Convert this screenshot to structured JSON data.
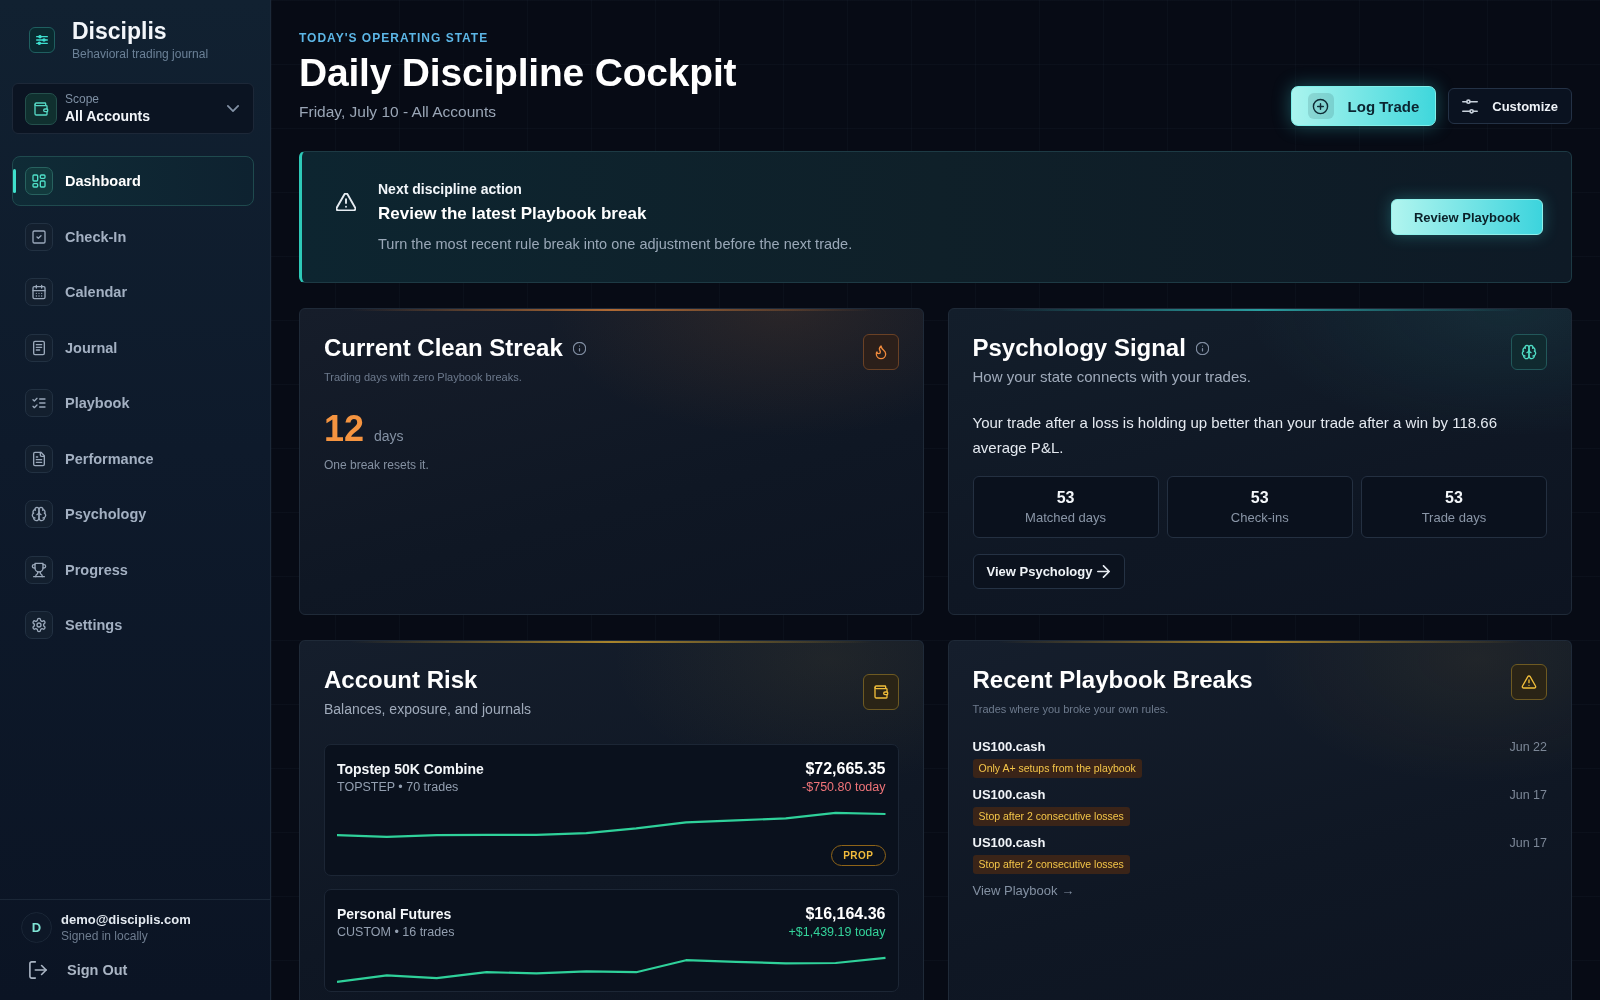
{
  "sidebar": {
    "brand": {
      "name": "Disciplis",
      "tagline": "Behavioral trading journal"
    },
    "scope": {
      "label": "Scope",
      "value": "All Accounts"
    },
    "nav": [
      {
        "label": "Dashboard",
        "selected": true
      },
      {
        "label": "Check-In",
        "selected": false
      },
      {
        "label": "Calendar",
        "selected": false
      },
      {
        "label": "Journal",
        "selected": false
      },
      {
        "label": "Playbook",
        "selected": false
      },
      {
        "label": "Performance",
        "selected": false
      },
      {
        "label": "Psychology",
        "selected": false
      },
      {
        "label": "Progress",
        "selected": false
      },
      {
        "label": "Settings",
        "selected": false
      }
    ],
    "user": {
      "initial": "D",
      "email": "demo@disciplis.com",
      "status": "Signed in locally"
    },
    "sign_out": "Sign Out"
  },
  "header": {
    "eyebrow": "TODAY'S OPERATING STATE",
    "title": "Daily Discipline Cockpit",
    "subtitle": "Friday, July 10 - All Accounts",
    "actions": [
      {
        "label": "Log Trade",
        "kind": "primary"
      },
      {
        "label": "Customize",
        "kind": "secondary"
      }
    ]
  },
  "banner": {
    "eyebrow": "Next discipline action",
    "title": "Review the latest Playbook break",
    "text": "Turn the most recent rule break into one adjustment before the next trade.",
    "button": "Review Playbook"
  },
  "streak_card": {
    "title": "Current Clean Streak",
    "subtitle": "Trading days with zero Playbook breaks.",
    "value": "12",
    "unit": "days",
    "note": "One break resets it."
  },
  "psychology_card": {
    "title": "Psychology Signal",
    "subtitle": "How your state connects with your trades.",
    "text": "Your trade after a loss is holding up better than your trade after a win by 118.66 average P&L.",
    "stats": [
      {
        "value": "53",
        "label": "Matched days"
      },
      {
        "value": "53",
        "label": "Check-ins"
      },
      {
        "value": "53",
        "label": "Trade days"
      }
    ],
    "button": "View Psychology"
  },
  "account_risk_card": {
    "title": "Account Risk",
    "subtitle": "Balances, exposure, and journals",
    "accounts": [
      {
        "name": "Topstep 50K Combine",
        "meta": "TOPSTEP • 70 trades",
        "balance": "$72,665.35",
        "change": "-$750.80 today",
        "loss": true,
        "badge": "PROP"
      },
      {
        "name": "Personal Futures",
        "meta": "CUSTOM • 16 trades",
        "balance": "$16,164.36",
        "change": "+$1,439.19 today",
        "loss": false
      }
    ]
  },
  "breaks_card": {
    "title": "Recent Playbook Breaks",
    "subtitle": "Trades where you broke your own rules.",
    "items": [
      {
        "symbol": "US100.cash",
        "date": "Jun 22",
        "rule": "Only A+ setups from the playbook"
      },
      {
        "symbol": "US100.cash",
        "date": "Jun 17",
        "rule": "Stop after 2 consecutive losses"
      },
      {
        "symbol": "US100.cash",
        "date": "Jun 17",
        "rule": "Stop after 2 consecutive losses"
      }
    ],
    "link": "View Playbook →"
  }
}
